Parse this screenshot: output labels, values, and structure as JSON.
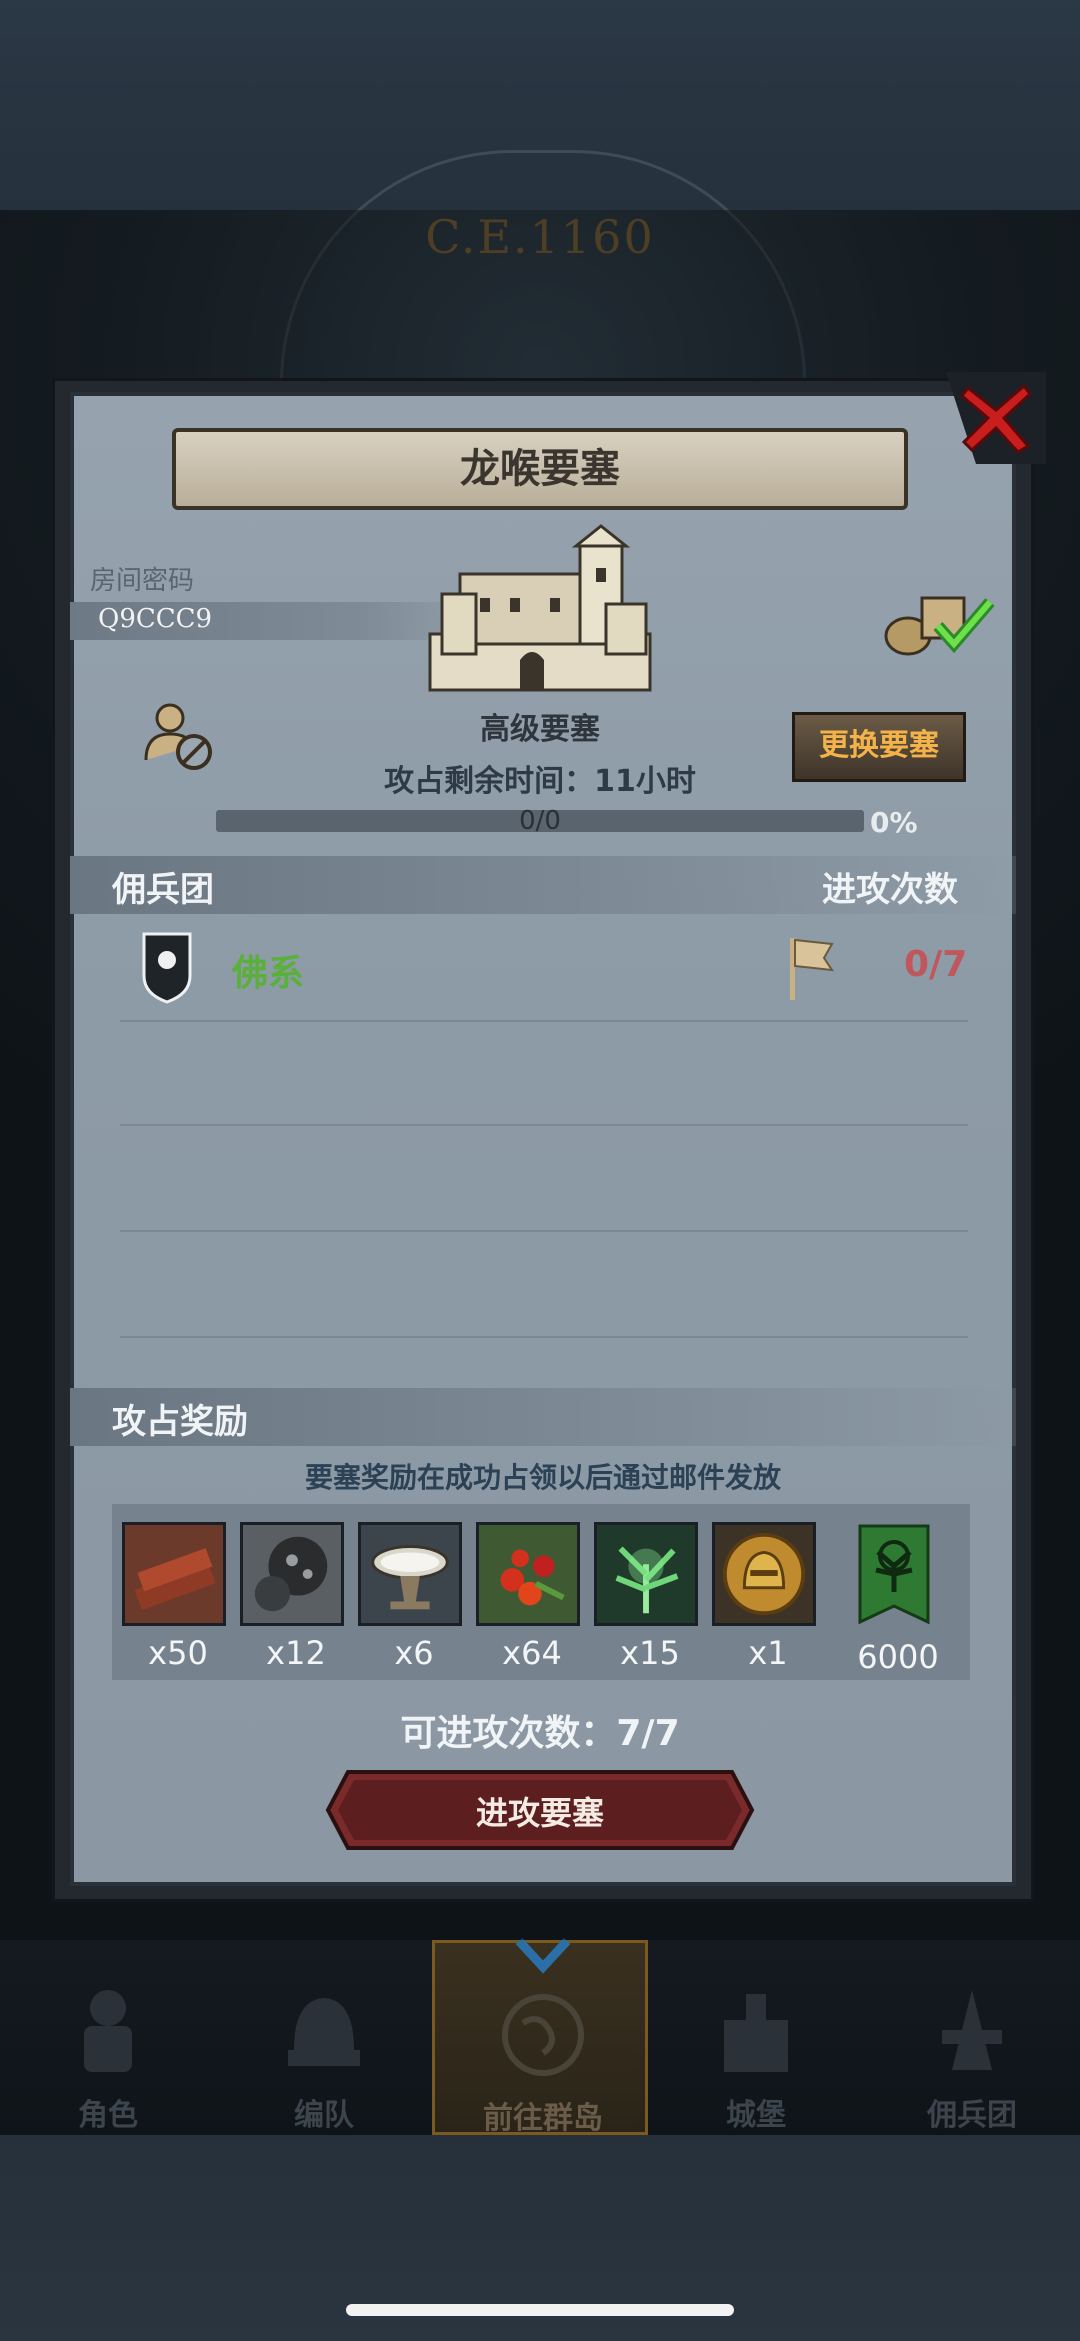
{
  "background": {
    "era": "C.E.1160"
  },
  "modal": {
    "title": "龙喉要塞",
    "room_password_label": "房间密码",
    "room_code": "Q9CCC9",
    "fortress_type": "高级要塞",
    "time_left": "攻占剩余时间：11小时",
    "change_button": "更换要塞",
    "progress": {
      "count": "0/0",
      "percent": "0%",
      "value": 0
    },
    "mercenary_section": {
      "title": "佣兵团",
      "attacks_header": "进攻次数"
    },
    "mercenaries": [
      {
        "name": "佛系",
        "attacks": "0/7"
      }
    ],
    "reward_section": {
      "title": "攻占奖励",
      "note": "要塞奖励在成功占领以后通过邮件发放",
      "items": [
        {
          "icon": "wood-icon",
          "qty": "x50"
        },
        {
          "icon": "ore-icon",
          "qty": "x12"
        },
        {
          "icon": "milk-bowl-icon",
          "qty": "x6"
        },
        {
          "icon": "berries-icon",
          "qty": "x64"
        },
        {
          "icon": "herb-icon",
          "qty": "x15"
        },
        {
          "icon": "helmet-medal-icon",
          "qty": "x1"
        },
        {
          "icon": "guild-banner-icon",
          "qty": "6000"
        }
      ]
    },
    "attempts_remaining": "可进攻次数：7/7",
    "attack_button": "进攻要塞"
  },
  "bottom_nav": [
    {
      "label": "角色",
      "icon": "knight-icon"
    },
    {
      "label": "编队",
      "icon": "helmet-icon"
    },
    {
      "label": "前往群岛",
      "icon": "globe-icon",
      "active": true
    },
    {
      "label": "城堡",
      "icon": "castle-icon"
    },
    {
      "label": "佣兵团",
      "icon": "mercenary-icon"
    }
  ],
  "colors": {
    "accent_gold": "#f4b34a",
    "merc_green": "#5ab03a",
    "attack_red": "#c0575c"
  }
}
